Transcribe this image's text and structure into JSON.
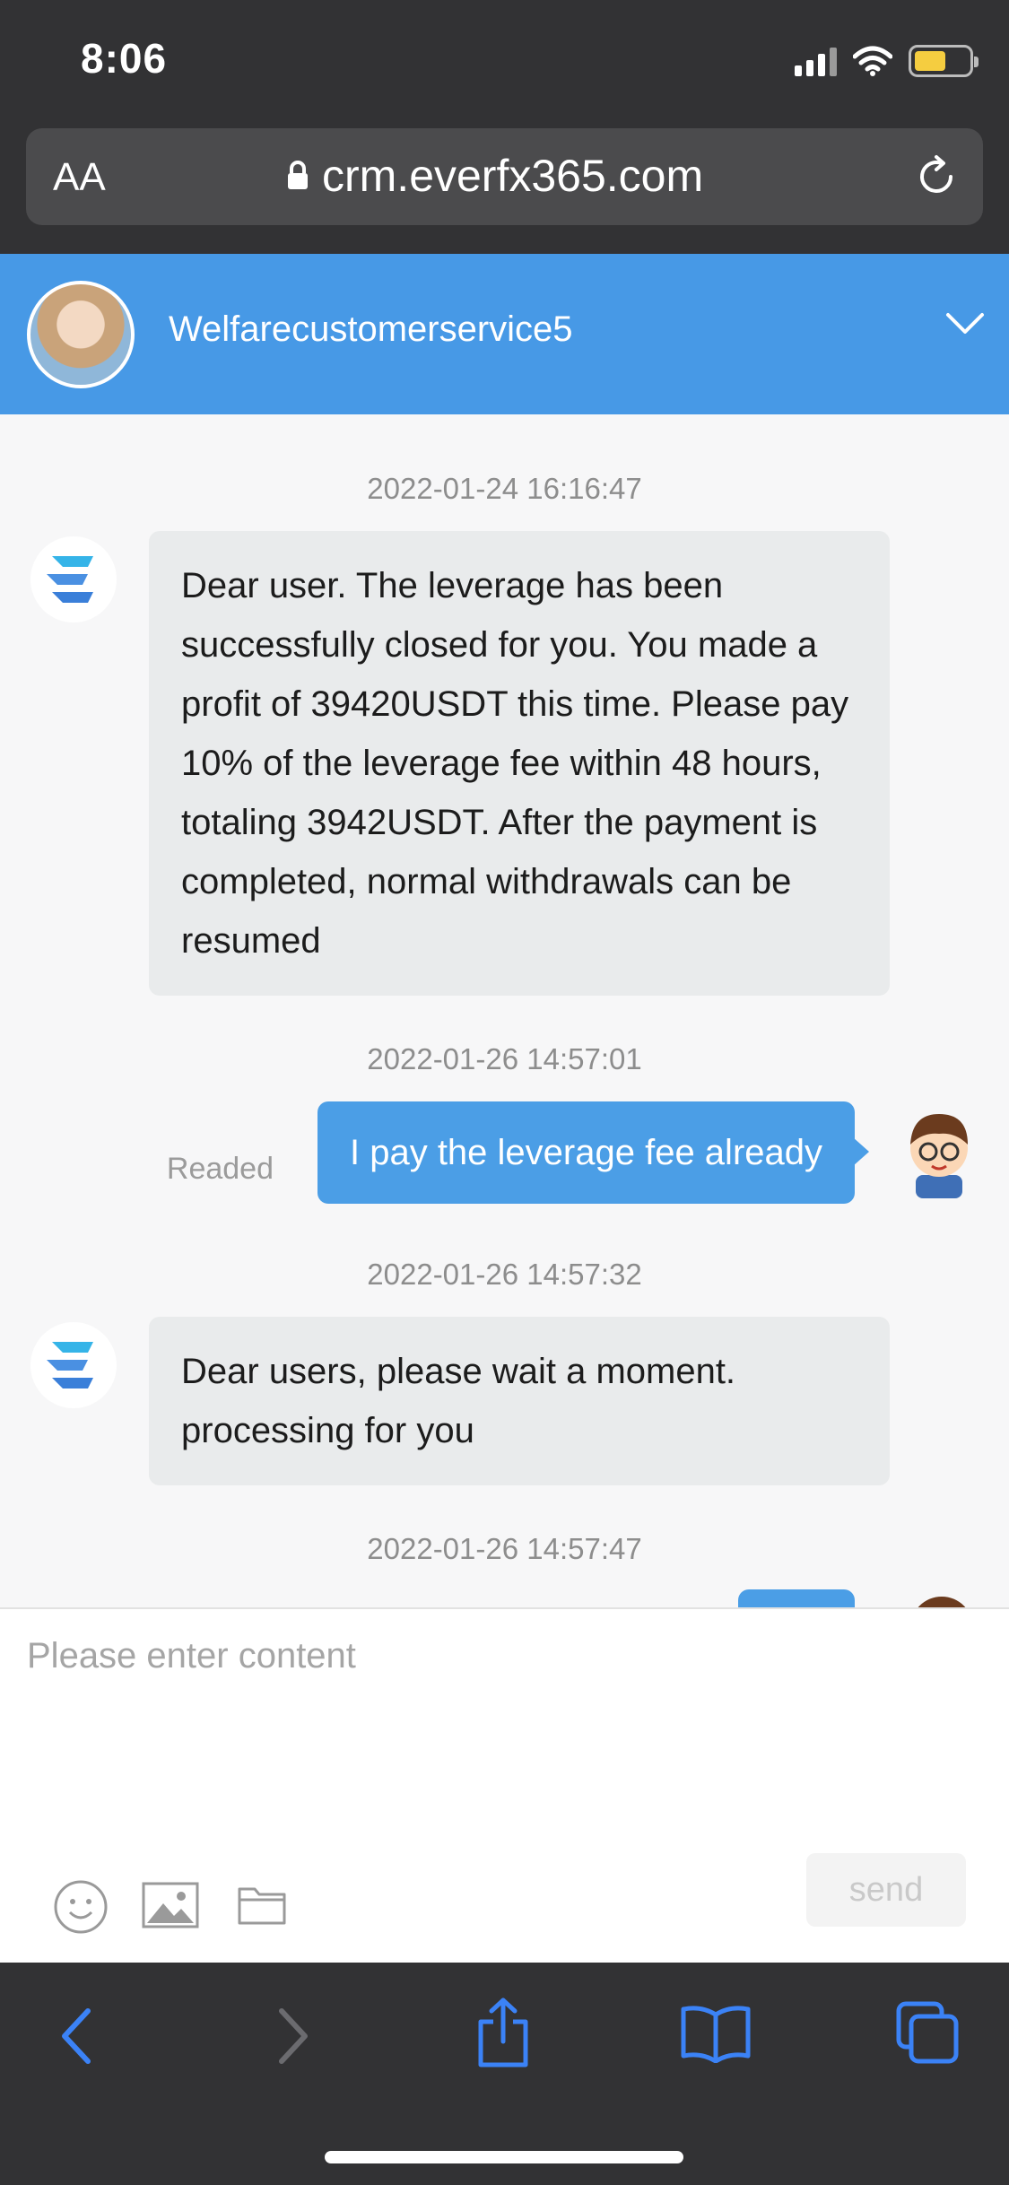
{
  "status_bar": {
    "time": "8:06"
  },
  "browser": {
    "text_size_label": "AA",
    "url": "crm.everfx365.com"
  },
  "chat_header": {
    "agent_name": "Welfarecustomerservice5"
  },
  "messages": [
    {
      "timestamp": "2022-01-24 16:16:47",
      "sender": "agent",
      "text": "Dear user. The leverage has been successfully closed for you. You made a profit of 39420USDT this time. Please pay 10% of the leverage fee within 48 hours, totaling 3942USDT. After the payment is completed, normal withdrawals can be resumed"
    },
    {
      "timestamp": "2022-01-26 14:57:01",
      "sender": "user",
      "text": "I pay the leverage fee already",
      "status": "Readed"
    },
    {
      "timestamp": "2022-01-26 14:57:32",
      "sender": "agent",
      "text": "Dear users, please wait a moment. processing for you"
    },
    {
      "timestamp": "2022-01-26 14:57:47",
      "sender": "user",
      "text": ""
    }
  ],
  "composer": {
    "placeholder": "Please enter content",
    "send_label": "send"
  },
  "colors": {
    "header_blue": "#4799e6",
    "user_bubble": "#4b9ee6",
    "agent_bubble": "#e9ebec",
    "browser_chrome": "#323234",
    "ios_blue": "#3b82f6"
  }
}
